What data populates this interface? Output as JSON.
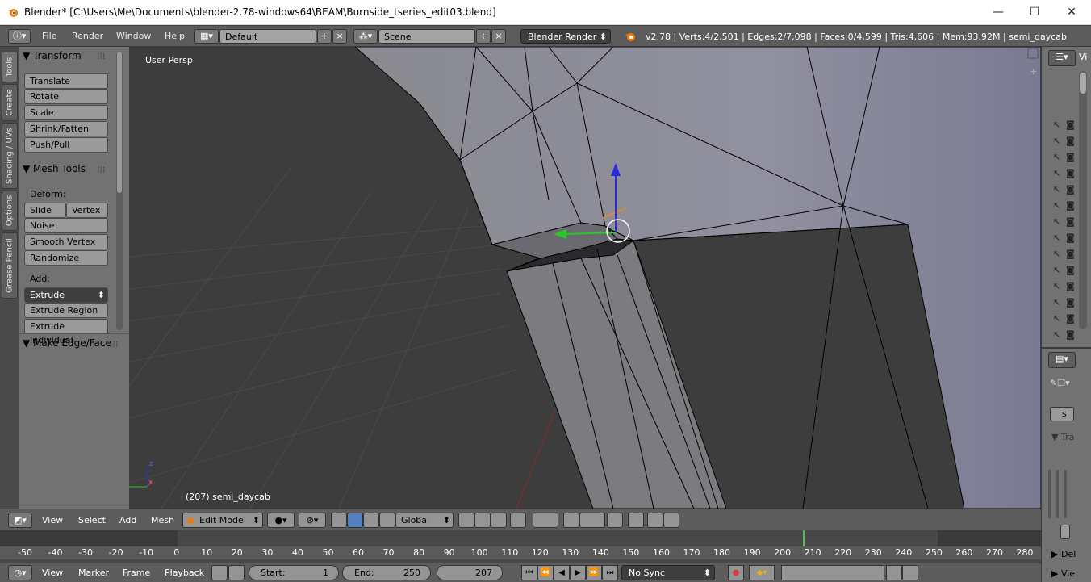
{
  "window": {
    "title": "Blender* [C:\\Users\\Me\\Documents\\blender-2.78-windows64\\BEAM\\Burnside_tseries_edit03.blend]",
    "minimize": "—",
    "maximize": "☐",
    "close": "✕"
  },
  "topbar": {
    "menus": [
      "File",
      "Render",
      "Window",
      "Help"
    ],
    "layout": "Default",
    "scene": "Scene",
    "engine": "Blender Render",
    "stats": "v2.78 | Verts:4/2,501 | Edges:2/7,098 | Faces:0/4,599 | Tris:4,606 | Mem:93.92M | semi_daycab"
  },
  "tabs": [
    "Tools",
    "Create",
    "Shading / UVs",
    "Options",
    "Grease Pencil"
  ],
  "toolshelf": {
    "transform_header": "Transform",
    "transform_buttons": [
      "Translate",
      "Rotate",
      "Scale",
      "Shrink/Fatten",
      "Push/Pull"
    ],
    "mesh_tools_header": "Mesh Tools",
    "deform_label": "Deform:",
    "slide_edge": "Slide Ed",
    "vertex": "Vertex",
    "noise": "Noise",
    "smooth_vertex": "Smooth Vertex",
    "randomize": "Randomize",
    "add_label": "Add:",
    "extrude": "Extrude",
    "extrude_region": "Extrude Region",
    "extrude_individual": "Extrude Individual",
    "make_edge_header": "Make Edge/Face"
  },
  "viewport": {
    "view_label": "User Persp",
    "object_label": "(207) semi_daycab",
    "axis_x": "x",
    "axis_z": "z"
  },
  "viewheader": {
    "menus": [
      "View",
      "Select",
      "Add",
      "Mesh"
    ],
    "mode": "Edit Mode",
    "orientation": "Global"
  },
  "timeline": {
    "ticks": [
      -50,
      -40,
      -30,
      -20,
      -10,
      0,
      10,
      20,
      30,
      40,
      50,
      60,
      70,
      80,
      90,
      100,
      110,
      120,
      130,
      140,
      150,
      160,
      170,
      180,
      190,
      200,
      210,
      220,
      230,
      240,
      250,
      260,
      270,
      280
    ],
    "current_frame_marker": 207
  },
  "timebar": {
    "menus": [
      "View",
      "Marker",
      "Frame",
      "Playback"
    ],
    "start_label": "Start:",
    "start_value": "1",
    "end_label": "End:",
    "end_value": "250",
    "current_frame": "207",
    "sync": "No Sync"
  },
  "outliner": {
    "header_text": "Vi"
  },
  "props": {
    "s_label": "s",
    "tra_label": "Tra",
    "del_label": "Del",
    "vie_label": "Vie"
  },
  "colors": {
    "accent_blue": "#5680c2",
    "header_gray": "#5c5c5c",
    "panel_gray": "#727272",
    "viewport_bg": "#3d3d3d",
    "mesh_fill": "#8e8e96"
  }
}
